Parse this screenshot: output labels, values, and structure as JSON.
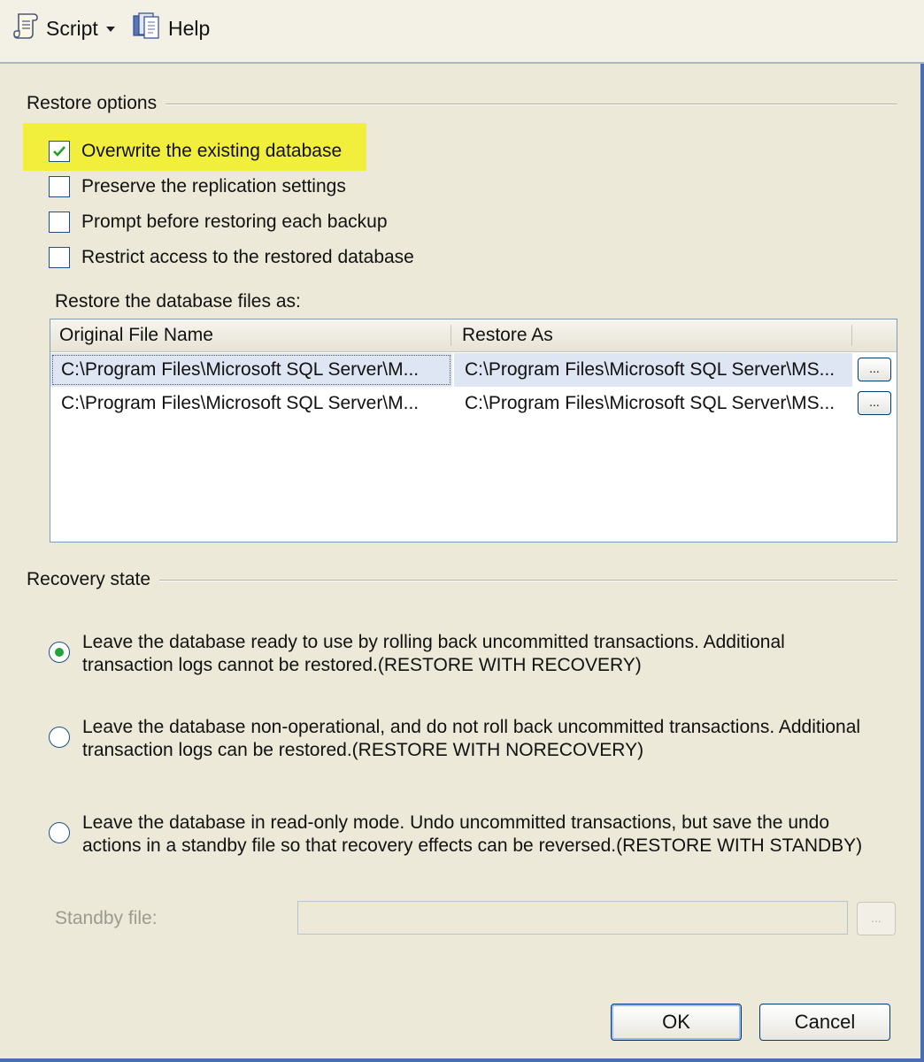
{
  "toolbar": {
    "script_label": "Script",
    "help_label": "Help"
  },
  "restore_options": {
    "title": "Restore options",
    "checkboxes": [
      {
        "label": "Overwrite the existing database",
        "checked": true
      },
      {
        "label": "Preserve the replication settings",
        "checked": false
      },
      {
        "label": "Prompt before restoring each backup",
        "checked": false
      },
      {
        "label": "Restrict access to the restored database",
        "checked": false
      }
    ],
    "files_label": "Restore the database files as:",
    "grid": {
      "columns": [
        "Original File Name",
        "Restore As"
      ],
      "rows": [
        {
          "original": "C:\\Program Files\\Microsoft SQL Server\\M...",
          "restore_as": "C:\\Program Files\\Microsoft SQL Server\\MS...",
          "browse": "..."
        },
        {
          "original": "C:\\Program Files\\Microsoft SQL Server\\M...",
          "restore_as": "C:\\Program Files\\Microsoft SQL Server\\MS...",
          "browse": "..."
        }
      ]
    }
  },
  "recovery_state": {
    "title": "Recovery state",
    "options": [
      {
        "line1": "Leave the database ready to use by rolling back uncommitted transactions. Additional",
        "line2": "transaction logs cannot be restored.(RESTORE WITH RECOVERY)",
        "selected": true
      },
      {
        "line1": "Leave the database non-operational, and do not roll back uncommitted transactions. Additional",
        "line2": "transaction logs can be restored.(RESTORE WITH NORECOVERY)",
        "selected": false
      },
      {
        "line1": "Leave the database in read-only mode. Undo uncommitted transactions, but save the undo",
        "line2": "actions in a standby file so that recovery effects can be reversed.(RESTORE WITH STANDBY)",
        "selected": false
      }
    ],
    "standby_label": "Standby file:",
    "standby_value": "",
    "standby_browse": "..."
  },
  "buttons": {
    "ok": "OK",
    "cancel": "Cancel"
  },
  "colors": {
    "highlight": "#f2ef3c",
    "window_bg": "#ece9d8",
    "border_blue": "#4a6fb0",
    "radio_dot": "#22a43b"
  }
}
